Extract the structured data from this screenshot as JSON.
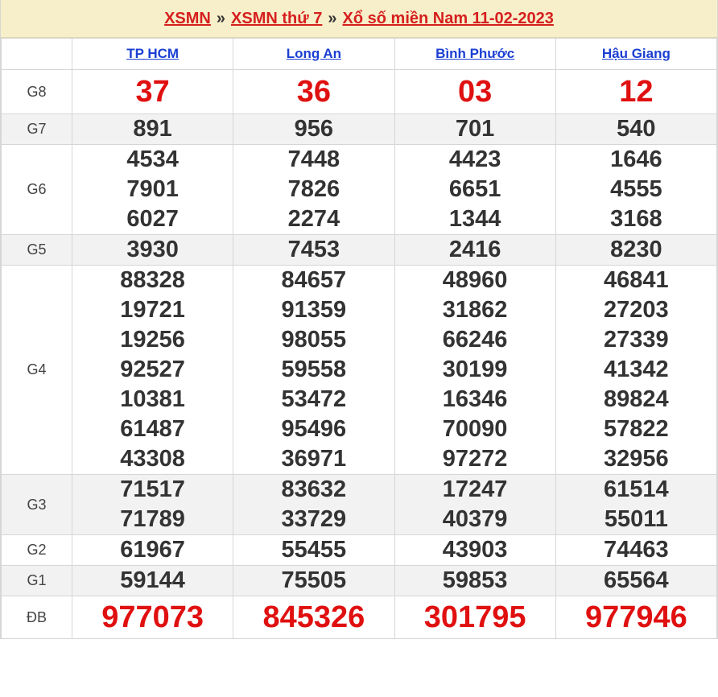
{
  "header": {
    "link1": "XSMN",
    "sep1": "»",
    "link2": "XSMN thứ 7",
    "sep2": "»",
    "link3": "Xổ số miền Nam 11-02-2023"
  },
  "provinces": [
    "TP HCM",
    "Long An",
    "Bình Phước",
    "Hậu Giang"
  ],
  "rows": {
    "g8": {
      "label": "G8",
      "values": [
        [
          "37"
        ],
        [
          "36"
        ],
        [
          "03"
        ],
        [
          "12"
        ]
      ]
    },
    "g7": {
      "label": "G7",
      "values": [
        [
          "891"
        ],
        [
          "956"
        ],
        [
          "701"
        ],
        [
          "540"
        ]
      ]
    },
    "g6": {
      "label": "G6",
      "values": [
        [
          "4534",
          "7901",
          "6027"
        ],
        [
          "7448",
          "7826",
          "2274"
        ],
        [
          "4423",
          "6651",
          "1344"
        ],
        [
          "1646",
          "4555",
          "3168"
        ]
      ]
    },
    "g5": {
      "label": "G5",
      "values": [
        [
          "3930"
        ],
        [
          "7453"
        ],
        [
          "2416"
        ],
        [
          "8230"
        ]
      ]
    },
    "g4": {
      "label": "G4",
      "values": [
        [
          "88328",
          "19721",
          "19256",
          "92527",
          "10381",
          "61487",
          "43308"
        ],
        [
          "84657",
          "91359",
          "98055",
          "59558",
          "53472",
          "95496",
          "36971"
        ],
        [
          "48960",
          "31862",
          "66246",
          "30199",
          "16346",
          "70090",
          "97272"
        ],
        [
          "46841",
          "27203",
          "27339",
          "41342",
          "89824",
          "57822",
          "32956"
        ]
      ]
    },
    "g3": {
      "label": "G3",
      "values": [
        [
          "71517",
          "71789"
        ],
        [
          "83632",
          "33729"
        ],
        [
          "17247",
          "40379"
        ],
        [
          "61514",
          "55011"
        ]
      ]
    },
    "g2": {
      "label": "G2",
      "values": [
        [
          "61967"
        ],
        [
          "55455"
        ],
        [
          "43903"
        ],
        [
          "74463"
        ]
      ]
    },
    "g1": {
      "label": "G1",
      "values": [
        [
          "59144"
        ],
        [
          "75505"
        ],
        [
          "59853"
        ],
        [
          "65564"
        ]
      ]
    },
    "db": {
      "label": "ĐB",
      "values": [
        [
          "977073"
        ],
        [
          "845326"
        ],
        [
          "301795"
        ],
        [
          "977946"
        ]
      ]
    }
  },
  "colors": {
    "red": "#e01010",
    "link_blue": "#1b3fd3",
    "header_bg": "#f7efc9",
    "alt_row": "#f2f2f2"
  }
}
